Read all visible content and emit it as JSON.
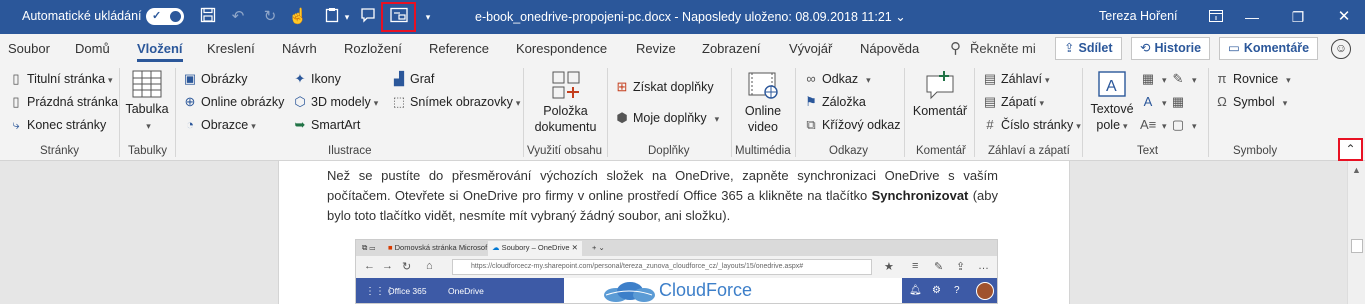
{
  "titlebar": {
    "autosave_label": "Automatické ukládání",
    "document_title": "e-book_onedrive-propojeni-pc.docx  -  Naposledy uloženo: 08.09.2018 11:21  ⌄",
    "user_name": "Tereza Hoření"
  },
  "tabs": [
    "Soubor",
    "Domů",
    "Vložení",
    "Kreslení",
    "Návrh",
    "Rozložení",
    "Reference",
    "Korespondence",
    "Revize",
    "Zobrazení",
    "Vývojář",
    "Nápověda"
  ],
  "active_tab": "Vložení",
  "tell_me": "Řekněte mi",
  "header_buttons": {
    "share": "Sdílet",
    "history": "Historie",
    "comments": "Komentáře"
  },
  "ribbon": {
    "pages": {
      "title_page": "Titulní stránka",
      "blank_page": "Prázdná stránka",
      "page_break": "Konec stránky",
      "label": "Stránky"
    },
    "tables": {
      "table": "Tabulka",
      "label": "Tabulky"
    },
    "illustrations": {
      "pictures": "Obrázky",
      "online_pictures": "Online obrázky",
      "shapes": "Obrazce",
      "icons": "Ikony",
      "models_3d": "3D modely",
      "smartart": "SmartArt",
      "chart": "Graf",
      "screenshot": "Snímek obrazovky",
      "label": "Ilustrace"
    },
    "content": {
      "document_item_line1": "Položka",
      "document_item_line2": "dokumentu",
      "label": "Využití obsahu"
    },
    "addins": {
      "get_addins": "Získat doplňky",
      "my_addins": "Moje doplňky",
      "label": "Doplňky"
    },
    "media": {
      "online_video_line1": "Online",
      "online_video_line2": "video",
      "label": "Multimédia"
    },
    "links": {
      "link": "Odkaz",
      "bookmark": "Záložka",
      "cross_reference": "Křížový odkaz",
      "label": "Odkazy"
    },
    "comments": {
      "comment": "Komentář",
      "label": "Komentář"
    },
    "header_footer": {
      "header": "Záhlaví",
      "footer": "Zápatí",
      "page_number": "Číslo stránky",
      "label": "Záhlaví a zápatí"
    },
    "text": {
      "textbox_line1": "Textové",
      "textbox_line2": "pole",
      "label": "Text"
    },
    "symbols": {
      "equation": "Rovnice",
      "symbol": "Symbol",
      "label": "Symboly"
    }
  },
  "document": {
    "para_part1": "Než se pustíte do přesměrování výchozích složek na OneDrive, zapněte synchronizaci OneDrive s vaším počítačem. Otevřete si OneDrive pro firmy v online prostředí Office 365 a klikněte na tlačítko ",
    "para_bold": "Synchronizovat",
    "para_part2": " (aby bylo toto tlačítko vidět, nesmíte mít vybraný žádný soubor, ani složku)."
  },
  "screenshot": {
    "tab1": "Domovská stránka Microsof",
    "tab2": "Soubory – OneDrive",
    "url": "https://cloudforcecz-my.sharepoint.com/personal/tereza_zunova_cloudforce_cz/_layouts/15/onedrive.aspx#",
    "office365": "Office 365",
    "onedrive": "OneDrive",
    "logo_text": "CloudForce"
  },
  "colors": {
    "word_blue": "#2b579a",
    "highlight_red": "#e81123",
    "sharepoint_bar": "#3d5aa6"
  }
}
